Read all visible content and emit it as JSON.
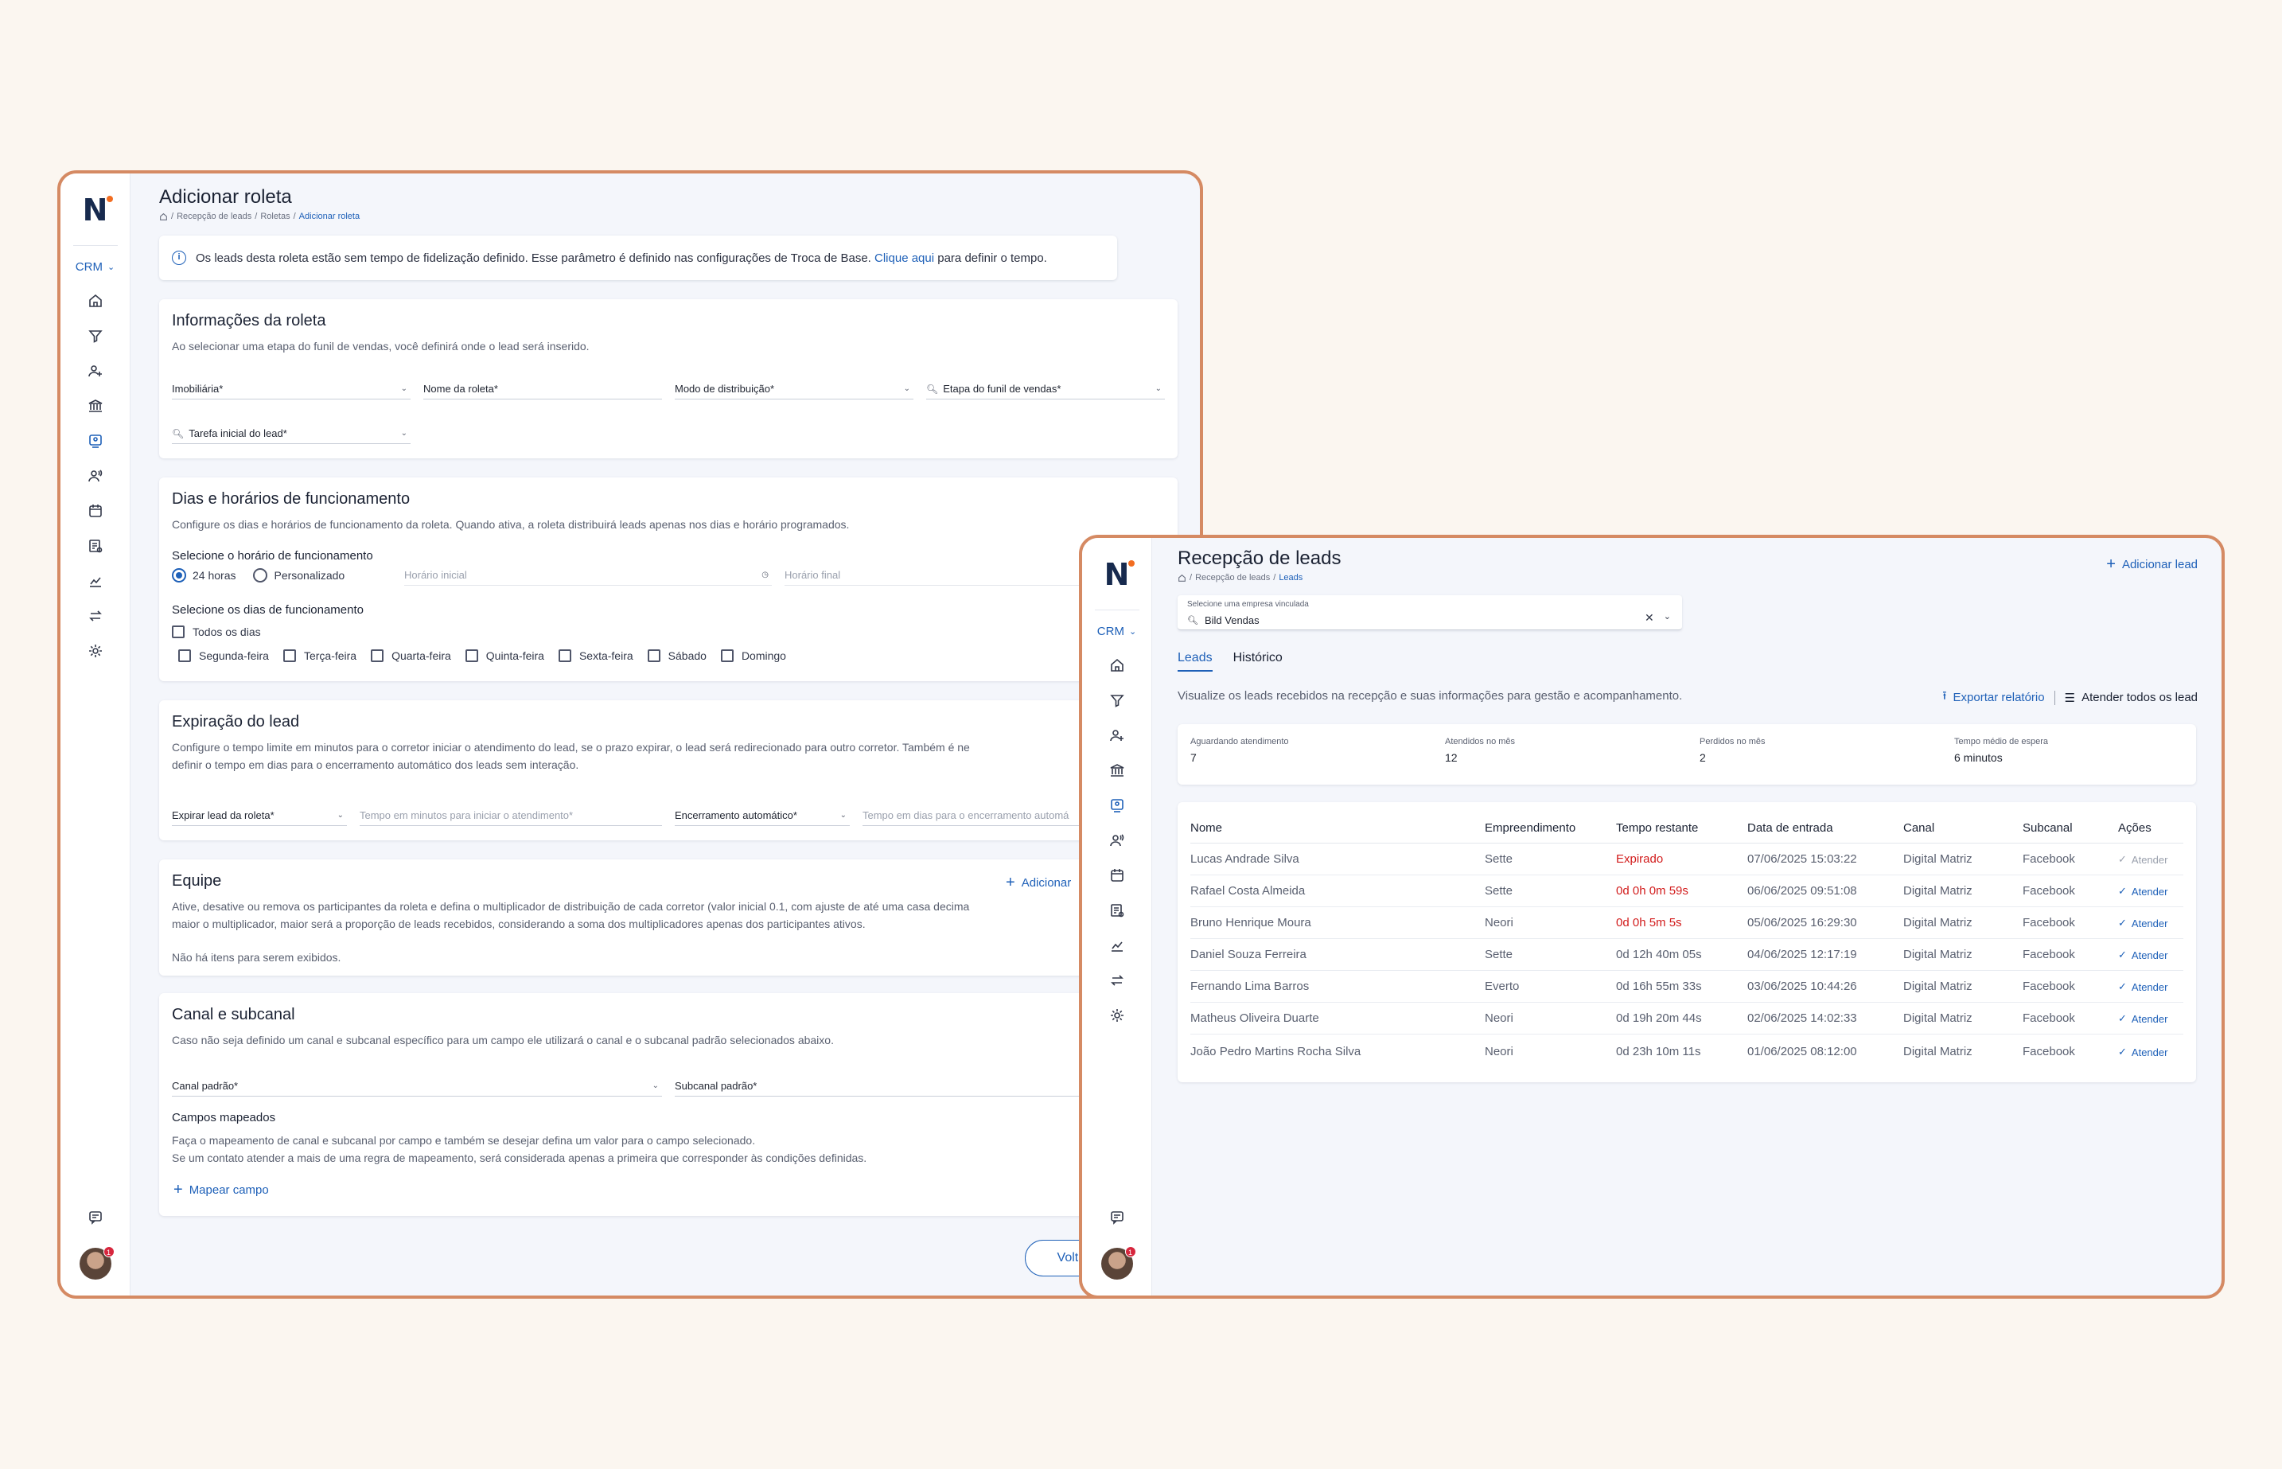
{
  "colors": {
    "accent": "#1e60b8",
    "window_border": "#d58a63",
    "danger": "#d21c1c",
    "logo_dot": "#f26d21"
  },
  "brand": {
    "logo": "N"
  },
  "rail": {
    "crm_label": "CRM",
    "icons": [
      "home-icon",
      "funnel-icon",
      "user-plus-icon",
      "bank-icon",
      "lead-reception-icon",
      "users-voice-icon",
      "calendar-icon",
      "report-icon",
      "chart-icon",
      "transfer-icon",
      "gear-icon"
    ],
    "bottom_icons": [
      "chat-icon",
      "avatar"
    ],
    "notification_count": "1"
  },
  "w1": {
    "title": "Adicionar roleta",
    "breadcrumb": [
      "Recepção de leads",
      "Roletas",
      "Adicionar roleta"
    ],
    "alert": {
      "text": "Os leads desta roleta estão sem tempo de fidelização definido. Esse parâmetro é definido nas configurações de Troca de Base.",
      "link": "Clique aqui",
      "suffix": "para definir o tempo."
    },
    "info": {
      "title": "Informações da roleta",
      "desc": "Ao selecionar uma etapa do funil de vendas, você definirá onde o lead será inserido.",
      "f_imob": "Imobiliária*",
      "f_nome": "Nome da roleta*",
      "f_modo": "Modo de distribuição*",
      "f_etapa": "Etapa do funil de vendas*",
      "f_tarefa": "Tarefa inicial do lead*"
    },
    "dias": {
      "title": "Dias e horários de funcionamento",
      "desc": "Configure os dias e horários de funcionamento da roleta. Quando ativa, a roleta distribuirá leads apenas nos dias e horário programados.",
      "horario_label": "Selecione o horário de funcionamento",
      "opt_24": "24 horas",
      "opt_pers": "Personalizado",
      "h_inicial": "Horário inicial",
      "h_final": "Horário final",
      "dias_label": "Selecione os dias de funcionamento",
      "todos": "Todos os dias",
      "days": [
        "Segunda-feira",
        "Terça-feira",
        "Quarta-feira",
        "Quinta-feira",
        "Sexta-feira",
        "Sábado",
        "Domingo"
      ]
    },
    "exp": {
      "title": "Expiração do lead",
      "desc1": "Configure o tempo limite em minutos para o corretor iniciar o atendimento do lead, se o prazo expirar, o lead será redirecionado para outro corretor. Também é ne",
      "desc2": "definir o tempo em dias para o encerramento automático dos leads sem interação.",
      "f_exp": "Expirar lead da roleta*",
      "f_tempo": "Tempo em minutos para iniciar o atendimento*",
      "f_enc": "Encerramento automático*",
      "f_dias": "Tempo em dias para o encerramento automá"
    },
    "equipe": {
      "title": "Equipe",
      "add": "Adicionar",
      "desc1": "Ative, desative ou remova os participantes da roleta e defina o multiplicador de distribuição de cada corretor (valor inicial 0.1, com ajuste de até uma casa decima",
      "desc2": "maior o multiplicador, maior será a proporção de leads recebidos, considerando a soma dos multiplicadores apenas dos participantes ativos.",
      "empty": "Não há itens para serem exibidos."
    },
    "canal": {
      "title": "Canal e subcanal",
      "desc": "Caso não seja definido um canal e subcanal específico para um campo ele utilizará o canal e o subcanal padrão selecionados abaixo.",
      "f_canal": "Canal padrão*",
      "f_sub": "Subcanal padrão*",
      "mapeados_title": "Campos mapeados",
      "mapeados_d1": "Faça o mapeamento de canal e subcanal por campo e também se desejar defina um valor para o campo selecionado.",
      "mapeados_d2": "Se um contato atender a mais de uma regra de mapeamento, será considerada apenas a primeira que corresponder às condições definidas.",
      "mapear": "Mapear campo"
    },
    "voltar": "Voltar"
  },
  "w2": {
    "title": "Recepção de leads",
    "breadcrumb": [
      "Recepção de leads",
      "Leads"
    ],
    "add_lead": "Adicionar lead",
    "company_caption": "Selecione uma empresa vinculada",
    "company_value": "Bild Vendas",
    "tabs": [
      "Leads",
      "Histórico"
    ],
    "subtitle": "Visualize os leads recebidos na recepção e suas informações para gestão e acompanhamento.",
    "export": "Exportar relatório",
    "attend_all": "Atender todos os lead",
    "stats": [
      {
        "k": "Aguardando atendimento",
        "v": "7"
      },
      {
        "k": "Atendidos no mês",
        "v": "12"
      },
      {
        "k": "Perdidos no mês",
        "v": "2"
      },
      {
        "k": "Tempo médio de espera",
        "v": "6 minutos"
      }
    ],
    "columns": [
      "Nome",
      "Empreendimento",
      "Tempo restante",
      "Data de entrada",
      "Canal",
      "Subcanal",
      "Ações"
    ],
    "rows": [
      {
        "nome": "Lucas Andrade Silva",
        "emp": "Sette",
        "tempo": "Expirado",
        "data": "07/06/2025 15:03:22",
        "canal": "Digital Matriz",
        "sub": "Facebook",
        "acao": "Atender"
      },
      {
        "nome": "Rafael Costa Almeida",
        "emp": "Sette",
        "tempo": "0d 0h 0m 59s",
        "data": "06/06/2025 09:51:08",
        "canal": "Digital Matriz",
        "sub": "Facebook",
        "acao": "Atender"
      },
      {
        "nome": "Bruno Henrique Moura",
        "emp": "Neori",
        "tempo": "0d 0h 5m 5s",
        "data": "05/06/2025 16:29:30",
        "canal": "Digital Matriz",
        "sub": "Facebook",
        "acao": "Atender"
      },
      {
        "nome": "Daniel Souza Ferreira",
        "emp": "Sette",
        "tempo": "0d 12h 40m 05s",
        "data": "04/06/2025 12:17:19",
        "canal": "Digital Matriz",
        "sub": "Facebook",
        "acao": "Atender"
      },
      {
        "nome": "Fernando Lima Barros",
        "emp": "Everto",
        "tempo": "0d 16h 55m 33s",
        "data": "03/06/2025 10:44:26",
        "canal": "Digital Matriz",
        "sub": "Facebook",
        "acao": "Atender"
      },
      {
        "nome": "Matheus Oliveira Duarte",
        "emp": "Neori",
        "tempo": "0d 19h 20m 44s",
        "data": "02/06/2025 14:02:33",
        "canal": "Digital Matriz",
        "sub": "Facebook",
        "acao": "Atender"
      },
      {
        "nome": "João Pedro Martins Rocha Silva",
        "emp": "Neori",
        "tempo": "0d 23h 10m 11s",
        "data": "01/06/2025 08:12:00",
        "canal": "Digital Matriz",
        "sub": "Facebook",
        "acao": "Atender"
      }
    ]
  }
}
